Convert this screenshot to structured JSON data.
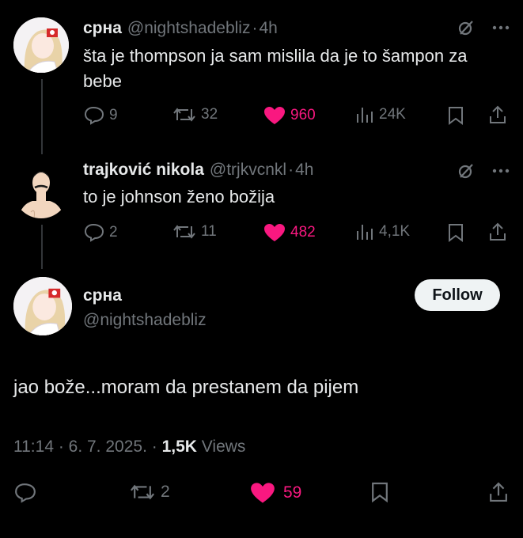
{
  "reply1": {
    "name": "срна",
    "handle": "@nightshadebliz",
    "dot": "·",
    "time": "4h",
    "text": "šta je thompson ja sam mislila da je to šampon za bebe",
    "replies": "9",
    "reposts": "32",
    "likes": "960",
    "views": "24K"
  },
  "reply2": {
    "name": "trajković nikola",
    "handle": "@trjkvcnkl",
    "dot": "·",
    "time": "4h",
    "text": "to je johnson ženo božija",
    "replies": "2",
    "reposts": "11",
    "likes": "482",
    "views": "4,1K"
  },
  "main": {
    "name": "срна",
    "handle": "@nightshadebliz",
    "follow_label": "Follow",
    "text": "jao bože...moram da prestanem da pijem",
    "timestamp": "11:14 · 6. 7. 2025. · ",
    "views_count": "1,5K",
    "views_label": "Views",
    "reposts": "2",
    "likes": "59"
  },
  "colors": {
    "background": "#000000",
    "text": "#e7e9ea",
    "muted": "#71767b",
    "like": "#f91880",
    "divider": "#333639"
  }
}
